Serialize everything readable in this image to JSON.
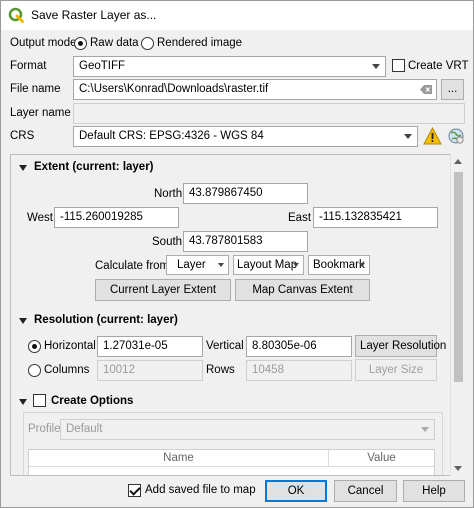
{
  "window": {
    "title": "Save Raster Layer as..."
  },
  "output_mode": {
    "label": "Output mode",
    "raw": "Raw data",
    "rendered": "Rendered image"
  },
  "format": {
    "label": "Format",
    "value": "GeoTIFF",
    "create_vrt": "Create VRT"
  },
  "file": {
    "label": "File name",
    "value": "C:\\Users\\Konrad\\Downloads\\raster.tif",
    "browse": "..."
  },
  "layer_name": {
    "label": "Layer name",
    "value": ""
  },
  "crs": {
    "label": "CRS",
    "value": "Default CRS: EPSG:4326 - WGS 84"
  },
  "extent": {
    "title": "Extent (current: layer)",
    "north_label": "North",
    "north": "43.879867450",
    "west_label": "West",
    "west": "-115.260019285",
    "east_label": "East",
    "east": "-115.132835421",
    "south_label": "South",
    "south": "43.787801583",
    "calc_label": "Calculate from",
    "layer_btn": "Layer",
    "layout_btn": "Layout Map",
    "bookmark_btn": "Bookmark",
    "current_layer_btn": "Current Layer Extent",
    "map_canvas_btn": "Map Canvas Extent"
  },
  "resolution": {
    "title": "Resolution (current: layer)",
    "horizontal_label": "Horizontal",
    "horizontal": "1.27031e-05",
    "vertical_label": "Vertical",
    "vertical": "8.80305e-06",
    "layer_res_btn": "Layer Resolution",
    "columns_label": "Columns",
    "columns": "10012",
    "rows_label": "Rows",
    "rows": "10458",
    "layer_size_btn": "Layer Size"
  },
  "create_options": {
    "title": "Create Options",
    "profile_label": "Profile",
    "profile_value": "Default",
    "col_name": "Name",
    "col_value": "Value"
  },
  "footer": {
    "add_to_map": "Add saved file to map",
    "ok": "OK",
    "cancel": "Cancel",
    "help": "Help"
  },
  "colors": {
    "accent": "#0078d7",
    "warning": "#f5c000",
    "qgis_green": "#589632"
  }
}
